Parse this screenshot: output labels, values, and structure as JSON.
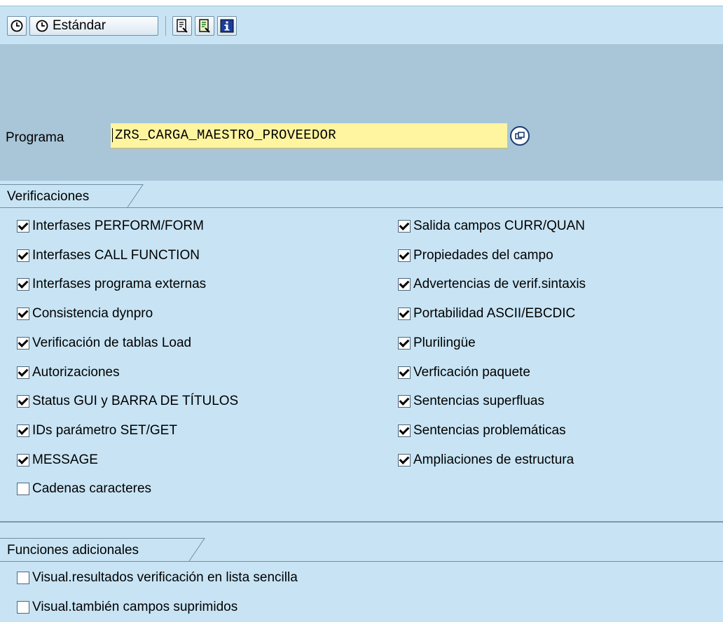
{
  "toolbar": {
    "standard_label": "Estándar"
  },
  "program": {
    "label": "Programa",
    "value": "ZRS_CARGA_MAESTRO_PROVEEDOR"
  },
  "verifications": {
    "title": "Verificaciones",
    "left": [
      {
        "label": "Interfases PERFORM/FORM",
        "checked": true
      },
      {
        "label": "Interfases CALL FUNCTION",
        "checked": true
      },
      {
        "label": "Interfases programa externas",
        "checked": true
      },
      {
        "label": "Consistencia dynpro",
        "checked": true
      },
      {
        "label": "Verificación de tablas Load",
        "checked": true
      },
      {
        "label": "Autorizaciones",
        "checked": true
      },
      {
        "label": "Status GUI y BARRA DE TÍTULOS",
        "checked": true
      },
      {
        "label": "IDs parámetro SET/GET",
        "checked": true
      },
      {
        "label": "MESSAGE",
        "checked": true
      },
      {
        "label": "Cadenas caracteres",
        "checked": false
      }
    ],
    "right": [
      {
        "label": "Salida campos CURR/QUAN",
        "checked": true
      },
      {
        "label": "Propiedades del campo",
        "checked": true
      },
      {
        "label": "Advertencias de verif.sintaxis",
        "checked": true
      },
      {
        "label": "Portabilidad ASCII/EBCDIC",
        "checked": true
      },
      {
        "label": "Plurilingüe",
        "checked": true
      },
      {
        "label": "Verficación paquete",
        "checked": true
      },
      {
        "label": "Sentencias superfluas",
        "checked": true
      },
      {
        "label": "Sentencias problemáticas",
        "checked": true
      },
      {
        "label": "Ampliaciones de estructura",
        "checked": true
      }
    ]
  },
  "additional": {
    "title": "Funciones adicionales",
    "items": [
      {
        "label": "Visual.resultados verificación en lista sencilla",
        "checked": false
      },
      {
        "label": "Visual.también campos suprimidos",
        "checked": false
      }
    ]
  },
  "icons": [
    "execute-clock-icon",
    "execute-background-icon",
    "document-icon",
    "document-green-icon",
    "info-icon",
    "possible-values-icon"
  ]
}
